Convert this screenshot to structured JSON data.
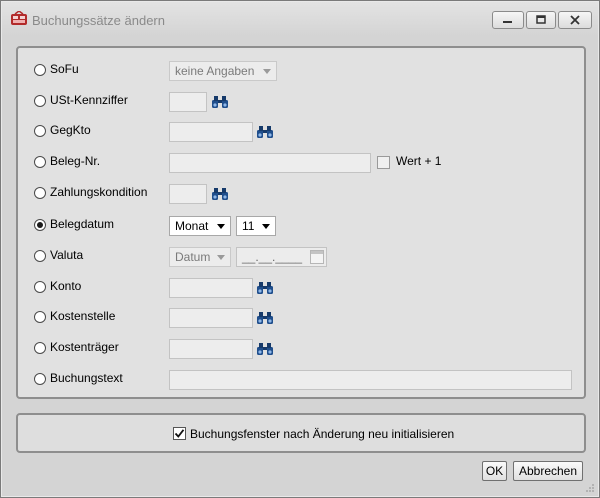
{
  "window": {
    "title": "Buchungssätze ändern",
    "icon": "app-icon",
    "controls": [
      "minimize-icon",
      "maximize-icon",
      "close-icon"
    ]
  },
  "fields": [
    {
      "key": "sofu",
      "label": "SoFu",
      "checked": false,
      "combo": "keine Angaben"
    },
    {
      "key": "ust",
      "label": "USt-Kennziffer",
      "checked": false
    },
    {
      "key": "gegkto",
      "label": "GegKto",
      "checked": false
    },
    {
      "key": "beleg_nr",
      "label": "Beleg-Nr.",
      "checked": false,
      "option_label": "Wert + 1"
    },
    {
      "key": "zahlungskondition",
      "label": "Zahlungskondition",
      "checked": false
    },
    {
      "key": "belegdatum",
      "label": "Belegdatum",
      "checked": true,
      "combo": "Monat",
      "combo2": "11"
    },
    {
      "key": "valuta",
      "label": "Valuta",
      "checked": false,
      "combo": "Datum",
      "date_placeholder": "__.__.____"
    },
    {
      "key": "konto",
      "label": "Konto",
      "checked": false
    },
    {
      "key": "kostenstelle",
      "label": "Kostenstelle",
      "checked": false
    },
    {
      "key": "kostentraeger",
      "label": "Kostenträger",
      "checked": false
    },
    {
      "key": "buchungstext",
      "label": "Buchungstext",
      "checked": false
    }
  ],
  "footer": {
    "init_label": "Buchungsfenster nach Änderung neu initialisieren",
    "init_checked": true,
    "ok_label": "OK",
    "cancel_label": "Abbrechen"
  },
  "colors": {
    "window_bg": "#d4d4d4",
    "panel_bg": "#e1e1e1",
    "panel_border": "#8e8e8e",
    "icon_blue": "#1f4e8c"
  }
}
